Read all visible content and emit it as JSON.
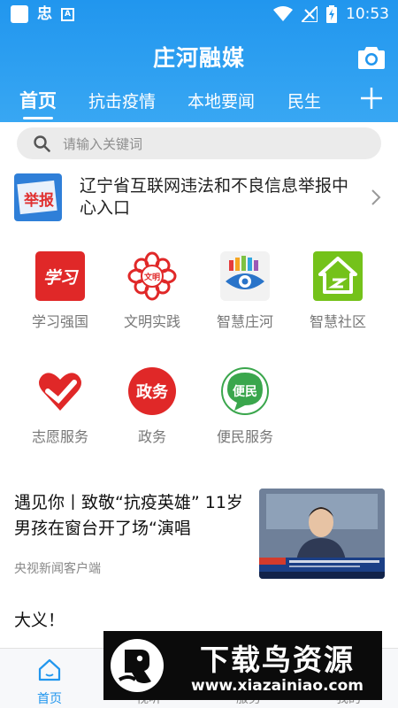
{
  "status_bar": {
    "time": "10:53",
    "notif_glyph": "忠",
    "notif_letter": "A"
  },
  "header": {
    "title": "庄河融媒",
    "camera_icon": "camera-icon",
    "tabs": [
      {
        "label": "首页",
        "active": true
      },
      {
        "label": "抗击疫情",
        "active": false
      },
      {
        "label": "本地要闻",
        "active": false
      },
      {
        "label": "民生",
        "active": false
      }
    ],
    "add_tab_icon": "plus-icon"
  },
  "search": {
    "placeholder": "请输入关键词"
  },
  "report_banner": {
    "icon_text": "举报",
    "text": "辽宁省互联网违法和不良信息举报中心入口"
  },
  "services": [
    {
      "label": "学习强国",
      "icon_text": "学习",
      "color": "#e02828"
    },
    {
      "label": "文明实践",
      "icon_text": "文明",
      "color": "#e02828"
    },
    {
      "label": "智慧庄河",
      "icon_text": "",
      "color": "#2a74c9"
    },
    {
      "label": "智慧社区",
      "icon_text": "",
      "color": "#74c21a"
    },
    {
      "label": "志愿服务",
      "icon_text": "",
      "color": "#e02828"
    },
    {
      "label": "政务",
      "icon_text": "政务",
      "color": "#e02828"
    },
    {
      "label": "便民服务",
      "icon_text": "便民",
      "color": "#3aa64c"
    }
  ],
  "news": [
    {
      "title": "遇见你丨致敬“抗疫英雄” 11岁男孩在窗台开了场“演唱",
      "source": "央视新闻客户端"
    }
  ],
  "news_continuation": "大义！",
  "bottom_nav": [
    {
      "label": "首页",
      "active": true
    },
    {
      "label": "视听",
      "active": false
    },
    {
      "label": "服务",
      "active": false
    },
    {
      "label": "我的",
      "active": false
    }
  ],
  "watermark": {
    "title": "下载鸟资源",
    "url": "www.xiazainiao.com"
  },
  "colors": {
    "brand_blue": "#2196ee",
    "search_bg": "#ebebeb"
  }
}
